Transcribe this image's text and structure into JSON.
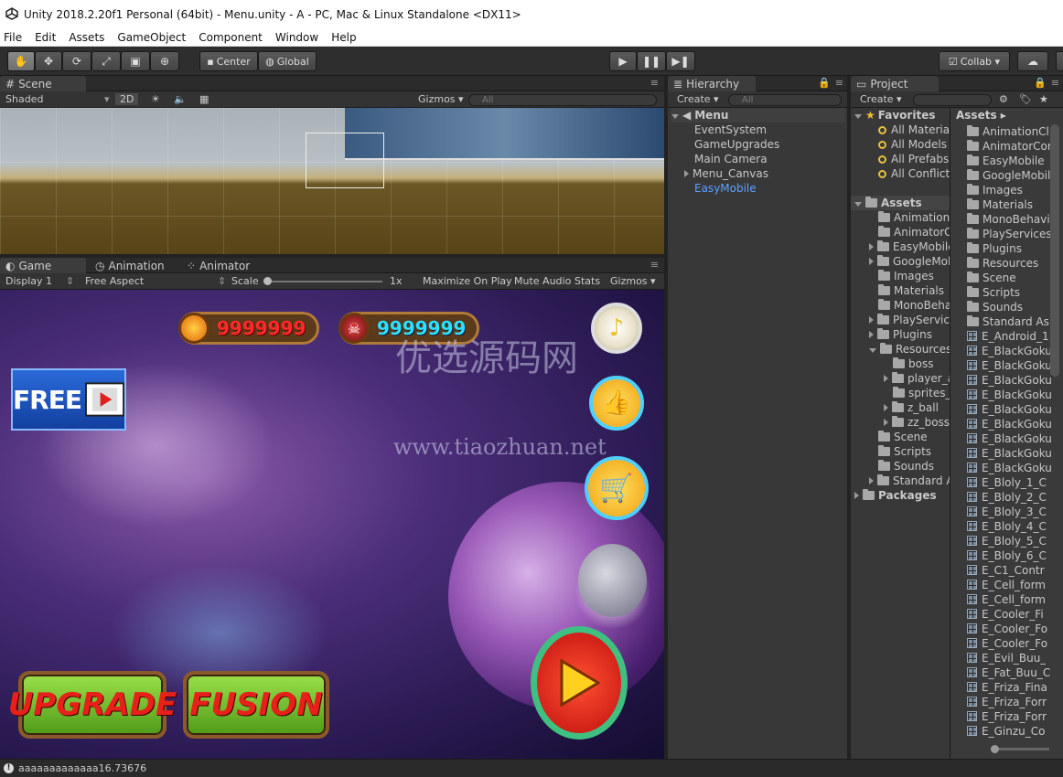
{
  "window": {
    "title": "Unity 2018.2.20f1 Personal (64bit) - Menu.unity - A - PC, Mac & Linux Standalone <DX11>"
  },
  "menu": [
    "File",
    "Edit",
    "Assets",
    "GameObject",
    "Component",
    "Window",
    "Help"
  ],
  "toolbar": {
    "center_label": "Center",
    "global_label": "Global",
    "collab_label": "Collab ▾"
  },
  "scene": {
    "tab": "Scene",
    "shaded": "Shaded",
    "mode_2d": "2D",
    "gizmos": "Gizmos ▾",
    "search": "All"
  },
  "game": {
    "tabs": [
      "Game",
      "Animation",
      "Animator"
    ],
    "display": "Display 1",
    "aspect": "Free Aspect",
    "scale_label": "Scale",
    "scale_value": "1x",
    "maximize": "Maximize On Play",
    "mute": "Mute Audio",
    "stats": "Stats",
    "gizmos": "Gizmos ▾",
    "coins": "9999999",
    "kills": "9999999",
    "free_label": "FREE",
    "upgrade_label": "UPGRADE",
    "fusion_label": "FUSION",
    "watermark_cn": "优选源码网",
    "watermark_url": "www.tiaozhuan.net"
  },
  "hierarchy": {
    "tab": "Hierarchy",
    "create": "Create ▾",
    "search": "All",
    "root": "Menu",
    "items": [
      "EventSystem",
      "GameUpgrades",
      "Main Camera",
      "Menu_Canvas",
      "EasyMobile"
    ]
  },
  "project": {
    "tab": "Project",
    "create": "Create ▾",
    "favorites": "Favorites",
    "fav_items": [
      "All Materia",
      "All Models",
      "All Prefabs",
      "All Conflict"
    ],
    "assets_label": "Assets",
    "tree": [
      "AnimationC",
      "AnimatorC",
      "EasyMobile",
      "GoogleMob",
      "Images",
      "Materials",
      "MonoBeha",
      "PlayServic",
      "Plugins",
      "Resources",
      "boss",
      "player_a",
      "sprites_",
      "z_ball",
      "zz_boss_",
      "Scene",
      "Scripts",
      "Sounds",
      "Standard A"
    ],
    "packages": "Packages",
    "breadcrumb": "Assets ▸",
    "folders": [
      "AnimationCl",
      "AnimatorCor",
      "EasyMobile",
      "GoogleMobil",
      "Images",
      "Materials",
      "MonoBehavi",
      "PlayServices",
      "Plugins",
      "Resources",
      "Scene",
      "Scripts",
      "Sounds",
      "Standard As"
    ],
    "files": [
      "E_Android_1",
      "E_BlackGoku",
      "E_BlackGoku",
      "E_BlackGoku",
      "E_BlackGoku",
      "E_BlackGoku",
      "E_BlackGoku",
      "E_BlackGoku",
      "E_BlackGoku",
      "E_BlackGoku",
      "E_Bloly_1_C",
      "E_Bloly_2_C",
      "E_Bloly_3_C",
      "E_Bloly_4_C",
      "E_Bloly_5_C",
      "E_Bloly_6_C",
      "E_C1_Contr",
      "E_Cell_form",
      "E_Cell_form",
      "E_Cooler_Fi",
      "E_Cooler_Fo",
      "E_Cooler_Fo",
      "E_Evil_Buu_",
      "E_Fat_Buu_C",
      "E_Friza_Fina",
      "E_Friza_Forr",
      "E_Friza_Forr",
      "E_Ginzu_Co"
    ]
  },
  "status": {
    "message": "aaaaaaaaaaaaa16.73676"
  }
}
